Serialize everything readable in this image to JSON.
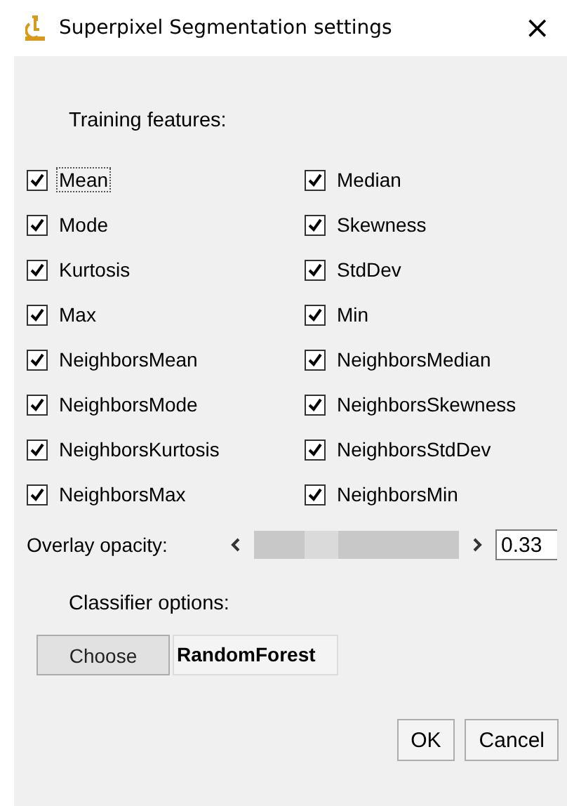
{
  "window": {
    "title": "Superpixel Segmentation settings",
    "close": "×"
  },
  "features_label": "Training features:",
  "features": [
    {
      "label": "Mean",
      "checked": true,
      "focused": true
    },
    {
      "label": "Median",
      "checked": true,
      "focused": false
    },
    {
      "label": "Mode",
      "checked": true,
      "focused": false
    },
    {
      "label": "Skewness",
      "checked": true,
      "focused": false
    },
    {
      "label": "Kurtosis",
      "checked": true,
      "focused": false
    },
    {
      "label": "StdDev",
      "checked": true,
      "focused": false
    },
    {
      "label": "Max",
      "checked": true,
      "focused": false
    },
    {
      "label": "Min",
      "checked": true,
      "focused": false
    },
    {
      "label": "NeighborsMean",
      "checked": true,
      "focused": false
    },
    {
      "label": "NeighborsMedian",
      "checked": true,
      "focused": false
    },
    {
      "label": "NeighborsMode",
      "checked": true,
      "focused": false
    },
    {
      "label": "NeighborsSkewness",
      "checked": true,
      "focused": false
    },
    {
      "label": "NeighborsKurtosis",
      "checked": true,
      "focused": false
    },
    {
      "label": "NeighborsStdDev",
      "checked": true,
      "focused": false
    },
    {
      "label": "NeighborsMax",
      "checked": true,
      "focused": false
    },
    {
      "label": "NeighborsMin",
      "checked": true,
      "focused": false
    }
  ],
  "opacity": {
    "label": "Overlay opacity:",
    "level": 0.33,
    "value": "0.33"
  },
  "classifier_label": "Classifier options:",
  "choose_button": "Choose",
  "classifier": "RandomForest",
  "buttons": [
    "OK",
    "Cancel"
  ]
}
